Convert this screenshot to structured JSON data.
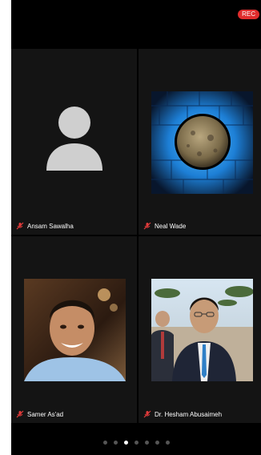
{
  "status": {
    "recording_label": "REC"
  },
  "participants": [
    {
      "name": "Ansam Sawalha",
      "muted": true
    },
    {
      "name": "Neal Wade",
      "muted": true
    },
    {
      "name": "Samer As'ad",
      "muted": true
    },
    {
      "name": "Dr. Hesham Abusaimeh",
      "muted": true
    }
  ],
  "pager": {
    "pages": 7,
    "active": 2
  },
  "colors": {
    "rec": "#e02c2c",
    "mic_muted": "#e23b3b",
    "glow": "#2aa6ff"
  }
}
